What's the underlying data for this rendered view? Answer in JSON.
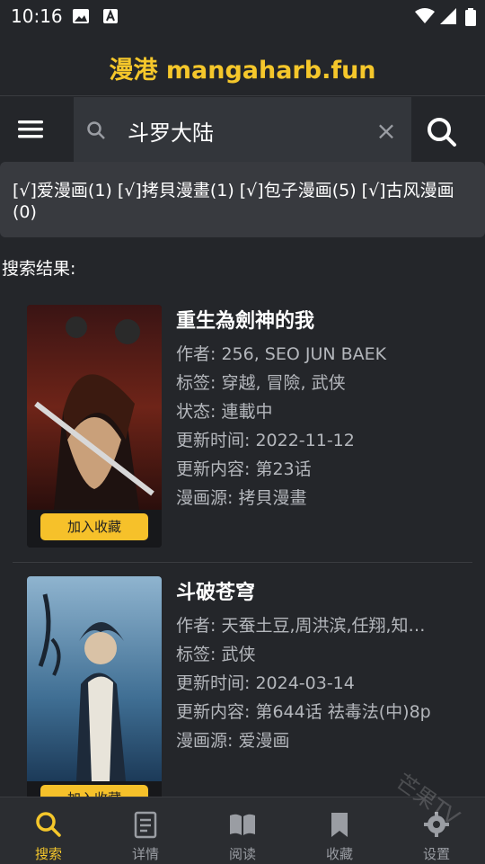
{
  "status": {
    "time": "10:16"
  },
  "header": {
    "title": "漫港 mangaharb.fun"
  },
  "search": {
    "value": "斗罗大陆",
    "clear": "×"
  },
  "sources": {
    "text": "[√]爱漫画(1) [√]拷貝漫畫(1) [√]包子漫画(5) [√]古风漫画(0)"
  },
  "results_label": "搜索结果:",
  "results": [
    {
      "title": "重生為劍神的我",
      "author": "作者: 256, SEO JUN BAEK",
      "tags": "标签: 穿越, 冒險, 武侠",
      "state": "状态: 連載中",
      "updated": "更新时间: 2022-11-12",
      "latest": "更新内容: 第23话",
      "source": "漫画源: 拷貝漫畫",
      "fav_label": "加入收藏"
    },
    {
      "title": "斗破苍穹",
      "author": "作者: 天蚕土豆,周洪滨,任翔,知…",
      "tags": "标签: 武侠",
      "updated": "更新时间: 2024-03-14",
      "latest": "更新内容: 第644话 祛毒法(中)8p",
      "source": "漫画源: 爱漫画",
      "fav_label": "加入收藏"
    }
  ],
  "nav": [
    {
      "label": "搜索",
      "icon": "search-icon",
      "active": true
    },
    {
      "label": "详情",
      "icon": "details-icon"
    },
    {
      "label": "阅读",
      "icon": "book-icon"
    },
    {
      "label": "收藏",
      "icon": "bookmark-icon"
    },
    {
      "label": "设置",
      "icon": "gear-icon"
    }
  ],
  "watermark": "芒果TV",
  "colors": {
    "accent": "#f5c72b",
    "background": "#24262a",
    "button": "#f6c12a"
  }
}
